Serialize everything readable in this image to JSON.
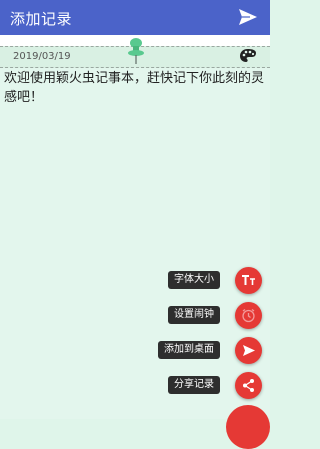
{
  "appbar": {
    "title": "添加记录",
    "send_icon": "send-icon"
  },
  "note": {
    "date": "2019/03/19",
    "pin_icon": "pin-icon",
    "palette_icon": "palette-icon",
    "text": "欢迎使用颖火虫记事本，赶快记下你此刻的灵感吧！"
  },
  "menu": [
    {
      "label": "字体大小",
      "icon": "font-size-icon"
    },
    {
      "label": "设置闹钟",
      "icon": "alarm-icon"
    },
    {
      "label": "添加到桌面",
      "icon": "add-to-desktop-icon"
    },
    {
      "label": "分享记录",
      "icon": "share-icon"
    }
  ],
  "colors": {
    "appbar": "#4b63c9",
    "fab": "#e53935",
    "note_bg": "#e3f6ed"
  }
}
